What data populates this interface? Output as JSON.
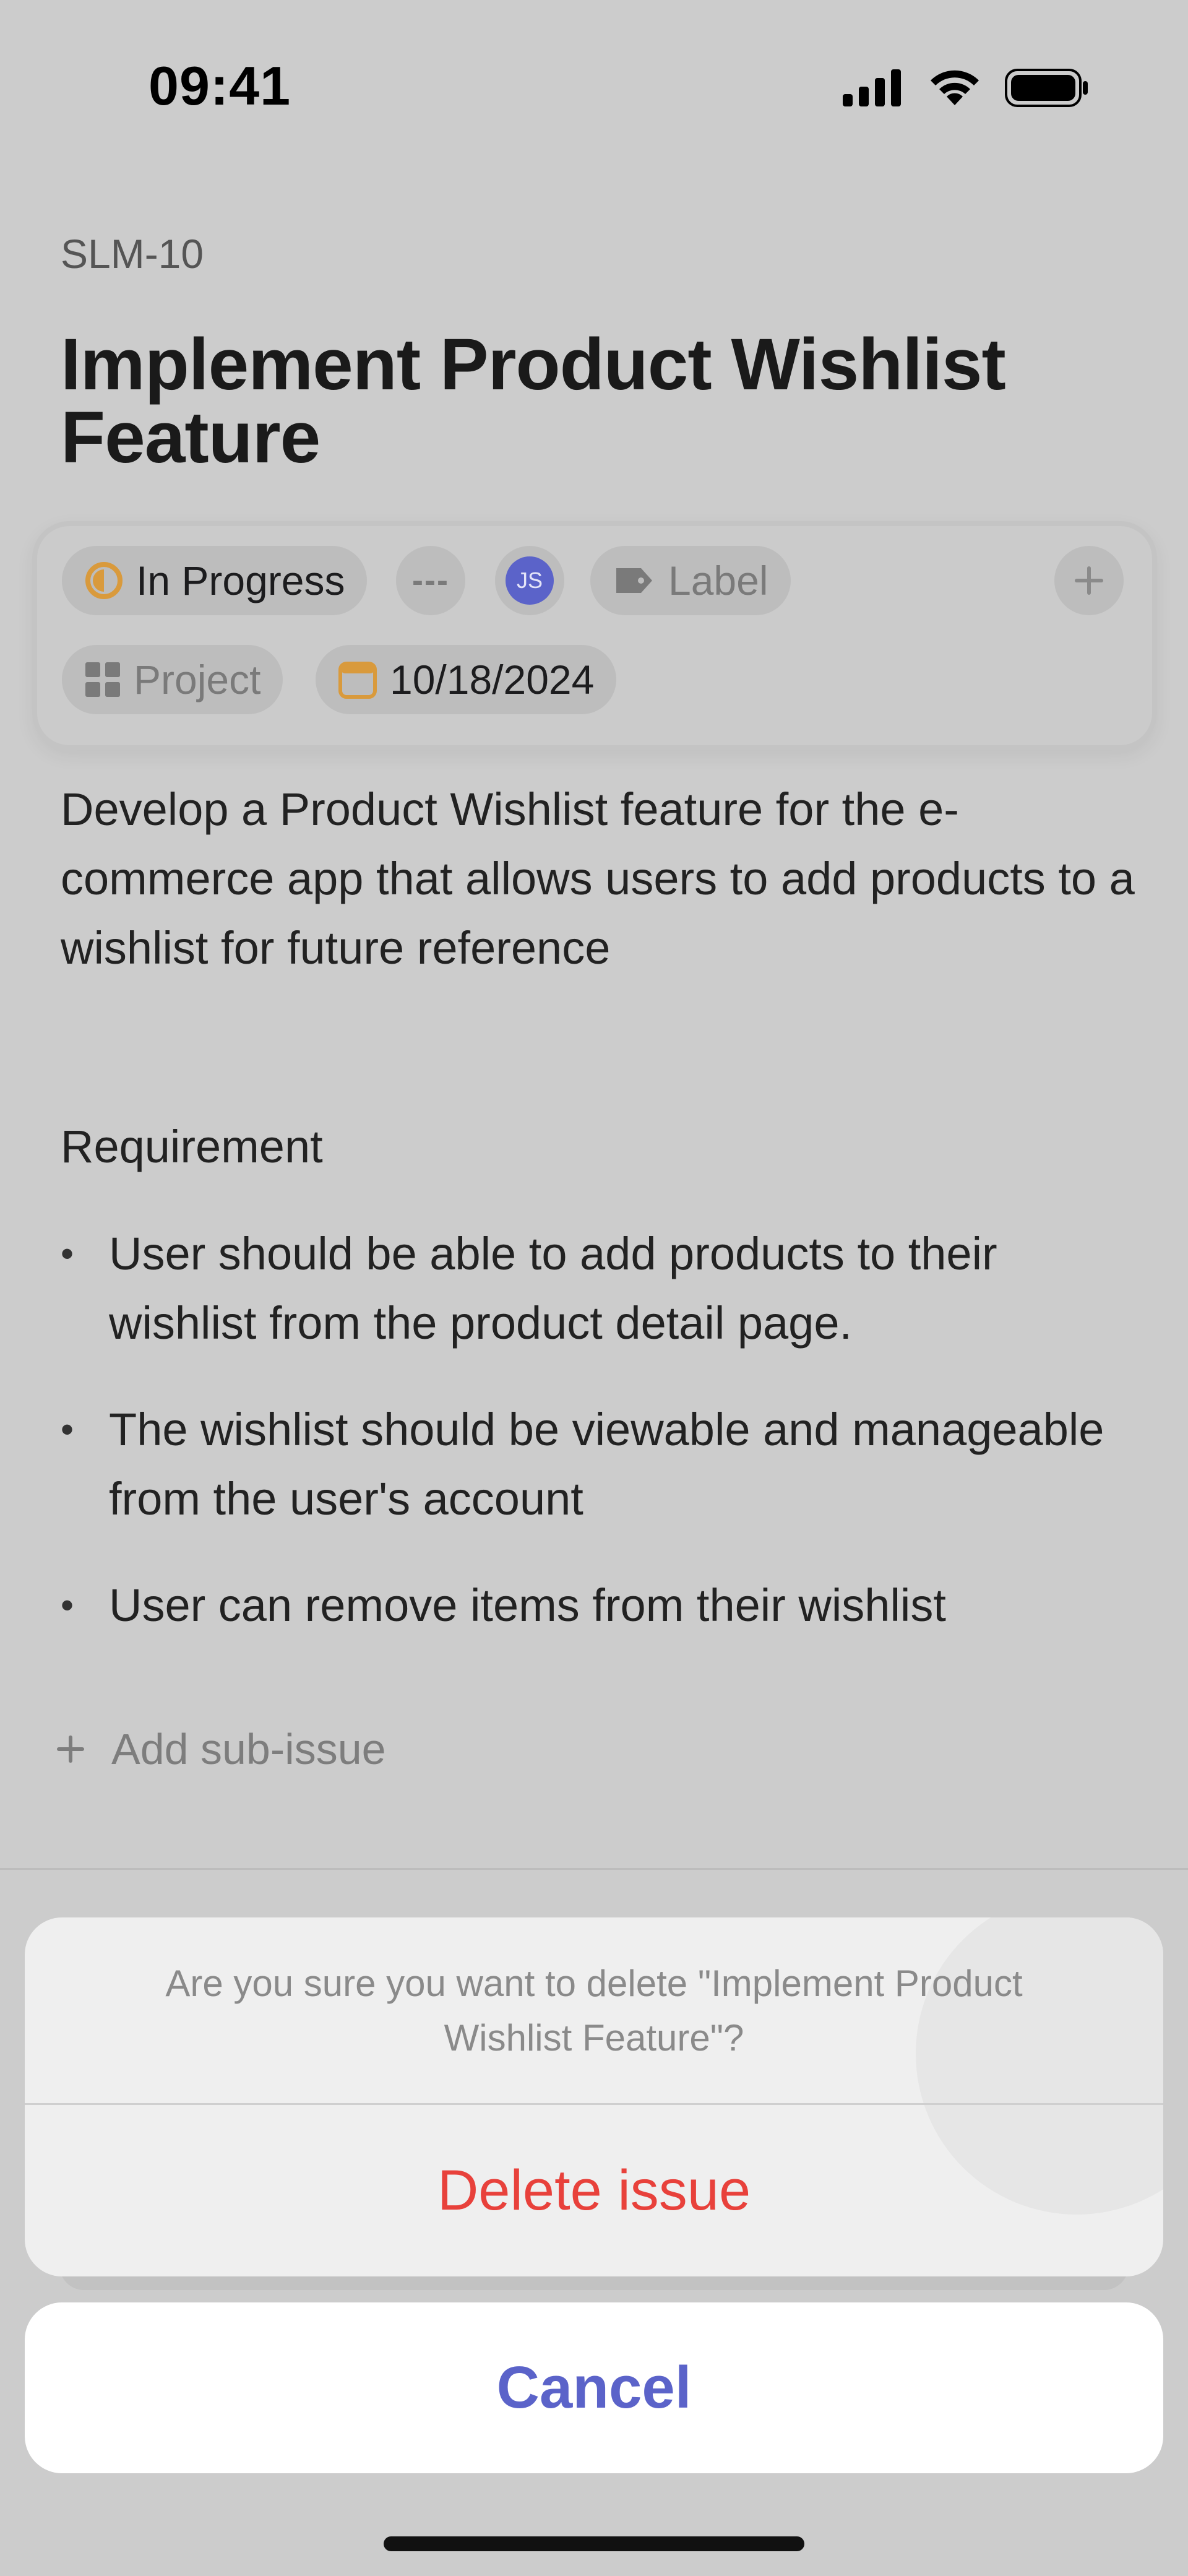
{
  "status_bar": {
    "time": "09:41"
  },
  "issue": {
    "id": "SLM-10",
    "title": "Implement Product Wishlist Feature",
    "properties": {
      "status": "In Progress",
      "priority": "---",
      "assignee_initials": "JS",
      "label": "Label",
      "project": "Project",
      "due_date": "10/18/2024"
    },
    "description": "Develop a Product Wishlist feature for the e-commerce app that allows users to add products to a wishlist for future reference",
    "requirement_heading": "Requirement",
    "requirements": [
      "User should be able to add products to their wishlist from the product detail page.",
      "The wishlist should be viewable and manageable from the user's account",
      "User can remove items from their wishlist"
    ],
    "add_sub_issue": "Add sub-issue"
  },
  "action_sheet": {
    "message": "Are you sure you want to delete \"Implement Product Wishlist Feature\"?",
    "delete_label": "Delete issue",
    "cancel_label": "Cancel"
  },
  "colors": {
    "accent": "#5b63c9",
    "destructive": "#e8413b",
    "status_in_progress": "#d99a3c"
  }
}
